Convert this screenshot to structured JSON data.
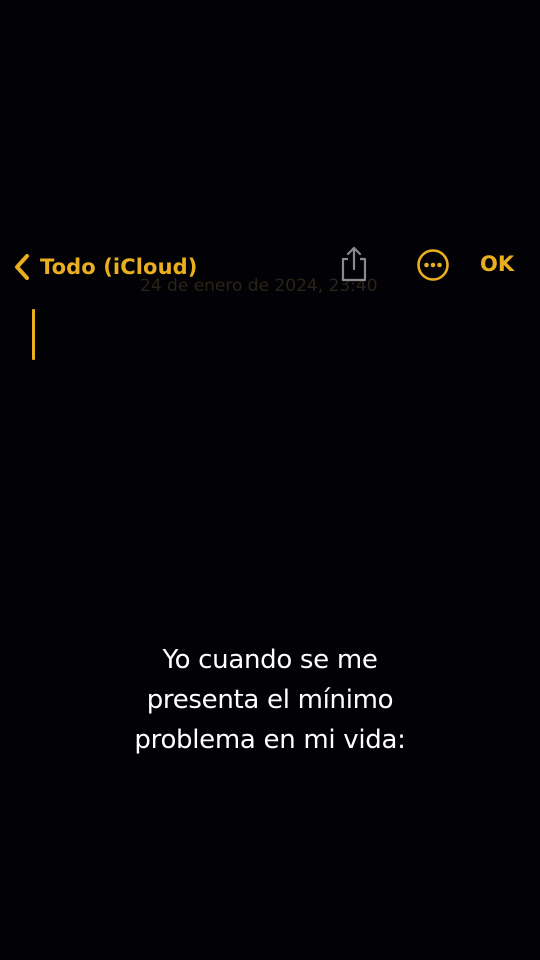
{
  "navbar": {
    "back_label": "Todo (iCloud)",
    "ok_label": "OK",
    "icons": {
      "back": "chevron-left-icon",
      "share": "share-icon",
      "more": "ellipsis-circle-icon"
    },
    "accent_color": "#E9AF1F"
  },
  "note": {
    "date_ghost": "24 de enero de 2024, 23:40"
  },
  "caption": {
    "line1": "Yo cuando se me",
    "line2": "presenta el mínimo",
    "line3": "problema en mi vida:"
  },
  "colors": {
    "background": "#020105",
    "accent": "#E9AF1F",
    "caption_text": "#FFFFFF"
  }
}
